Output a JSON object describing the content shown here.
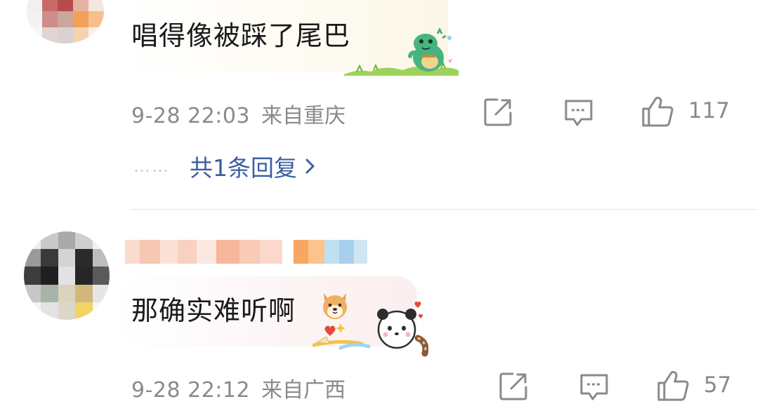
{
  "comments": [
    {
      "text": "唱得像被踩了尾巴",
      "time": "9-28 22:03",
      "location": "来自重庆",
      "likes": "117",
      "reply": {
        "dots": "……",
        "label": "共1条回复"
      },
      "sticker": "dinosaur-sticker"
    },
    {
      "text": "那确实难听啊",
      "emoji": "shiba-dog-emoji",
      "time": "9-28 22:12",
      "location": "来自广西",
      "likes": "57",
      "sticker": "panda-sticker"
    }
  ],
  "icons": {
    "share": "share-icon",
    "comment": "comment-icon",
    "like": "thumbs-up-icon",
    "chevron": "chevron-right-icon"
  },
  "colors": {
    "link": "#3b5fa0",
    "meta": "#8a8a8a",
    "text": "#1a1a1a"
  }
}
